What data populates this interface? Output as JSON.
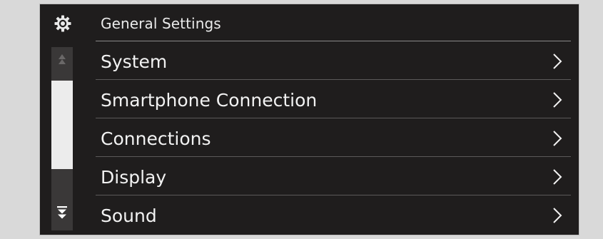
{
  "header": {
    "icon": "gear-icon",
    "title": "General Settings"
  },
  "scrollbar": {
    "up_icon": "double-chevron-up-icon",
    "down_icon": "double-chevron-down-icon"
  },
  "menu": {
    "items": [
      {
        "label": "System",
        "icon": "chevron-right-icon"
      },
      {
        "label": "Smartphone Connection",
        "icon": "chevron-right-icon"
      },
      {
        "label": "Connections",
        "icon": "chevron-right-icon"
      },
      {
        "label": "Display",
        "icon": "chevron-right-icon"
      },
      {
        "label": "Sound",
        "icon": "chevron-right-icon"
      }
    ]
  },
  "colors": {
    "screen_background": "#1f1d1d",
    "text": "#f2f2f2",
    "scroll_thumb": "#ececec"
  }
}
